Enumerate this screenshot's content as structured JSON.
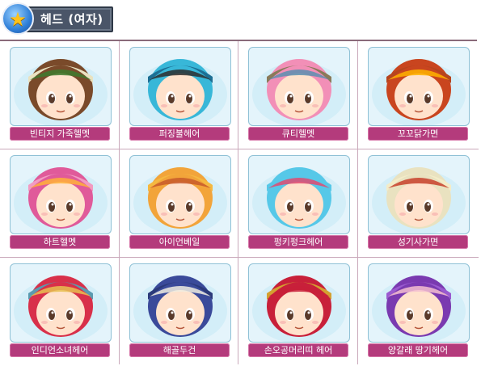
{
  "header": {
    "title": "헤드 (여자)",
    "icon": "star-icon"
  },
  "items": [
    {
      "label": "빈티지 가죽헬멧",
      "icon": "vintage-leather-helmet-icon",
      "hair": "#7a4a2a",
      "hat": "#e9e2c0",
      "accent": "#3e7a2e"
    },
    {
      "label": "퍼징불헤어",
      "icon": "fuzzing-hair-icon",
      "hair": "#38b7d8",
      "hat": "#1d6f94",
      "accent": "#2e2e2e"
    },
    {
      "label": "큐티헬멧",
      "icon": "cutie-helmet-icon",
      "hair": "#f28fb7",
      "hat": "#8a7a5a",
      "accent": "#5c8fb0"
    },
    {
      "label": "꼬꼬닭가면",
      "icon": "chicken-mask-icon",
      "hair": "#c9451f",
      "hat": "#b5451f",
      "accent": "#ffb300"
    },
    {
      "label": "하트헬멧",
      "icon": "heart-helmet-icon",
      "hair": "#e05a9a",
      "hat": "#f29ac2",
      "accent": "#ffb23a"
    },
    {
      "label": "아이언베일",
      "icon": "iron-veil-icon",
      "hair": "#f2a43a",
      "hat": "#f5b840",
      "accent": "#c85a2a"
    },
    {
      "label": "펑키펑크헤어",
      "icon": "funky-punk-hair-icon",
      "hair": "#56c8e8",
      "hat": "#56c8e8",
      "accent": "#e04a70"
    },
    {
      "label": "성기사가면",
      "icon": "paladin-mask-icon",
      "hair": "#e9e2c0",
      "hat": "#f3ecc8",
      "accent": "#c8402a"
    },
    {
      "label": "인디언소녀헤어",
      "icon": "indian-girl-hair-icon",
      "hair": "#d8304a",
      "hat": "#5a9ab0",
      "accent": "#e8c050"
    },
    {
      "label": "해골두건",
      "icon": "skull-bandana-icon",
      "hair": "#3a4a9a",
      "hat": "#2b3a7a",
      "accent": "#f0ece0"
    },
    {
      "label": "손오공머리띠 헤어",
      "icon": "sun-wukong-headband-hair-icon",
      "hair": "#c8203a",
      "hat": "#d4a030",
      "accent": "#c8203a"
    },
    {
      "label": "양갈래 땅기헤어",
      "icon": "twin-braid-hair-icon",
      "hair": "#7a3ab0",
      "hat": "#9a5ad0",
      "accent": "#f5c0d0"
    }
  ]
}
